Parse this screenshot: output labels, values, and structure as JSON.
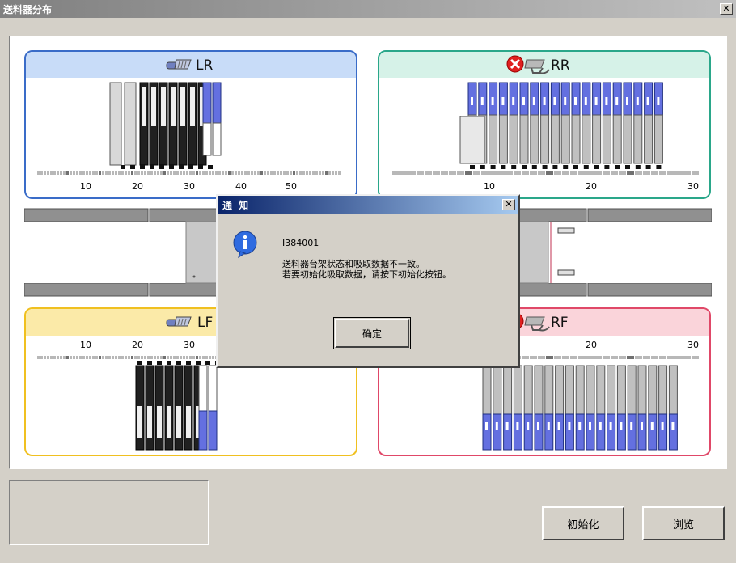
{
  "window": {
    "title": "送料器分布",
    "close_glyph": "✕"
  },
  "colors": {
    "lr_border": "#3a6cc8",
    "lr_head": "#c8dcf8",
    "rr_border": "#2aa78a",
    "rr_head": "#d6f2e8",
    "lf_border": "#f0c020",
    "lf_head": "#fbeaa8",
    "rf_border": "#e04868",
    "rf_head": "#fad4da",
    "feeder_blue": "#6470e0"
  },
  "quadrants": {
    "lr": {
      "label": "LR",
      "icon": "feeder-icon",
      "ticks": [
        "10",
        "20",
        "30",
        "40",
        "50"
      ]
    },
    "rr": {
      "label": "RR",
      "icon": "disconnected-feeder-icon",
      "status_icon": "error-icon",
      "ticks": [
        "10",
        "20",
        "30"
      ]
    },
    "lf": {
      "label": "LF",
      "icon": "feeder-icon",
      "ticks": [
        "10",
        "20",
        "30"
      ]
    },
    "rf": {
      "label": "RF",
      "icon": "disconnected-feeder-icon",
      "status_icon": "error-icon",
      "ticks": [
        "20",
        "30"
      ]
    }
  },
  "buttons": {
    "initialize": "初始化",
    "browse": "浏览"
  },
  "dialog": {
    "title": "通  知",
    "icon": "info-icon",
    "code": "I384001",
    "message_line1": "送料器台架状态和吸取数据不一致。",
    "message_line2": "若要初始化吸取数据，请按下初始化按钮。",
    "ok": "确定",
    "close_glyph": "✕"
  }
}
